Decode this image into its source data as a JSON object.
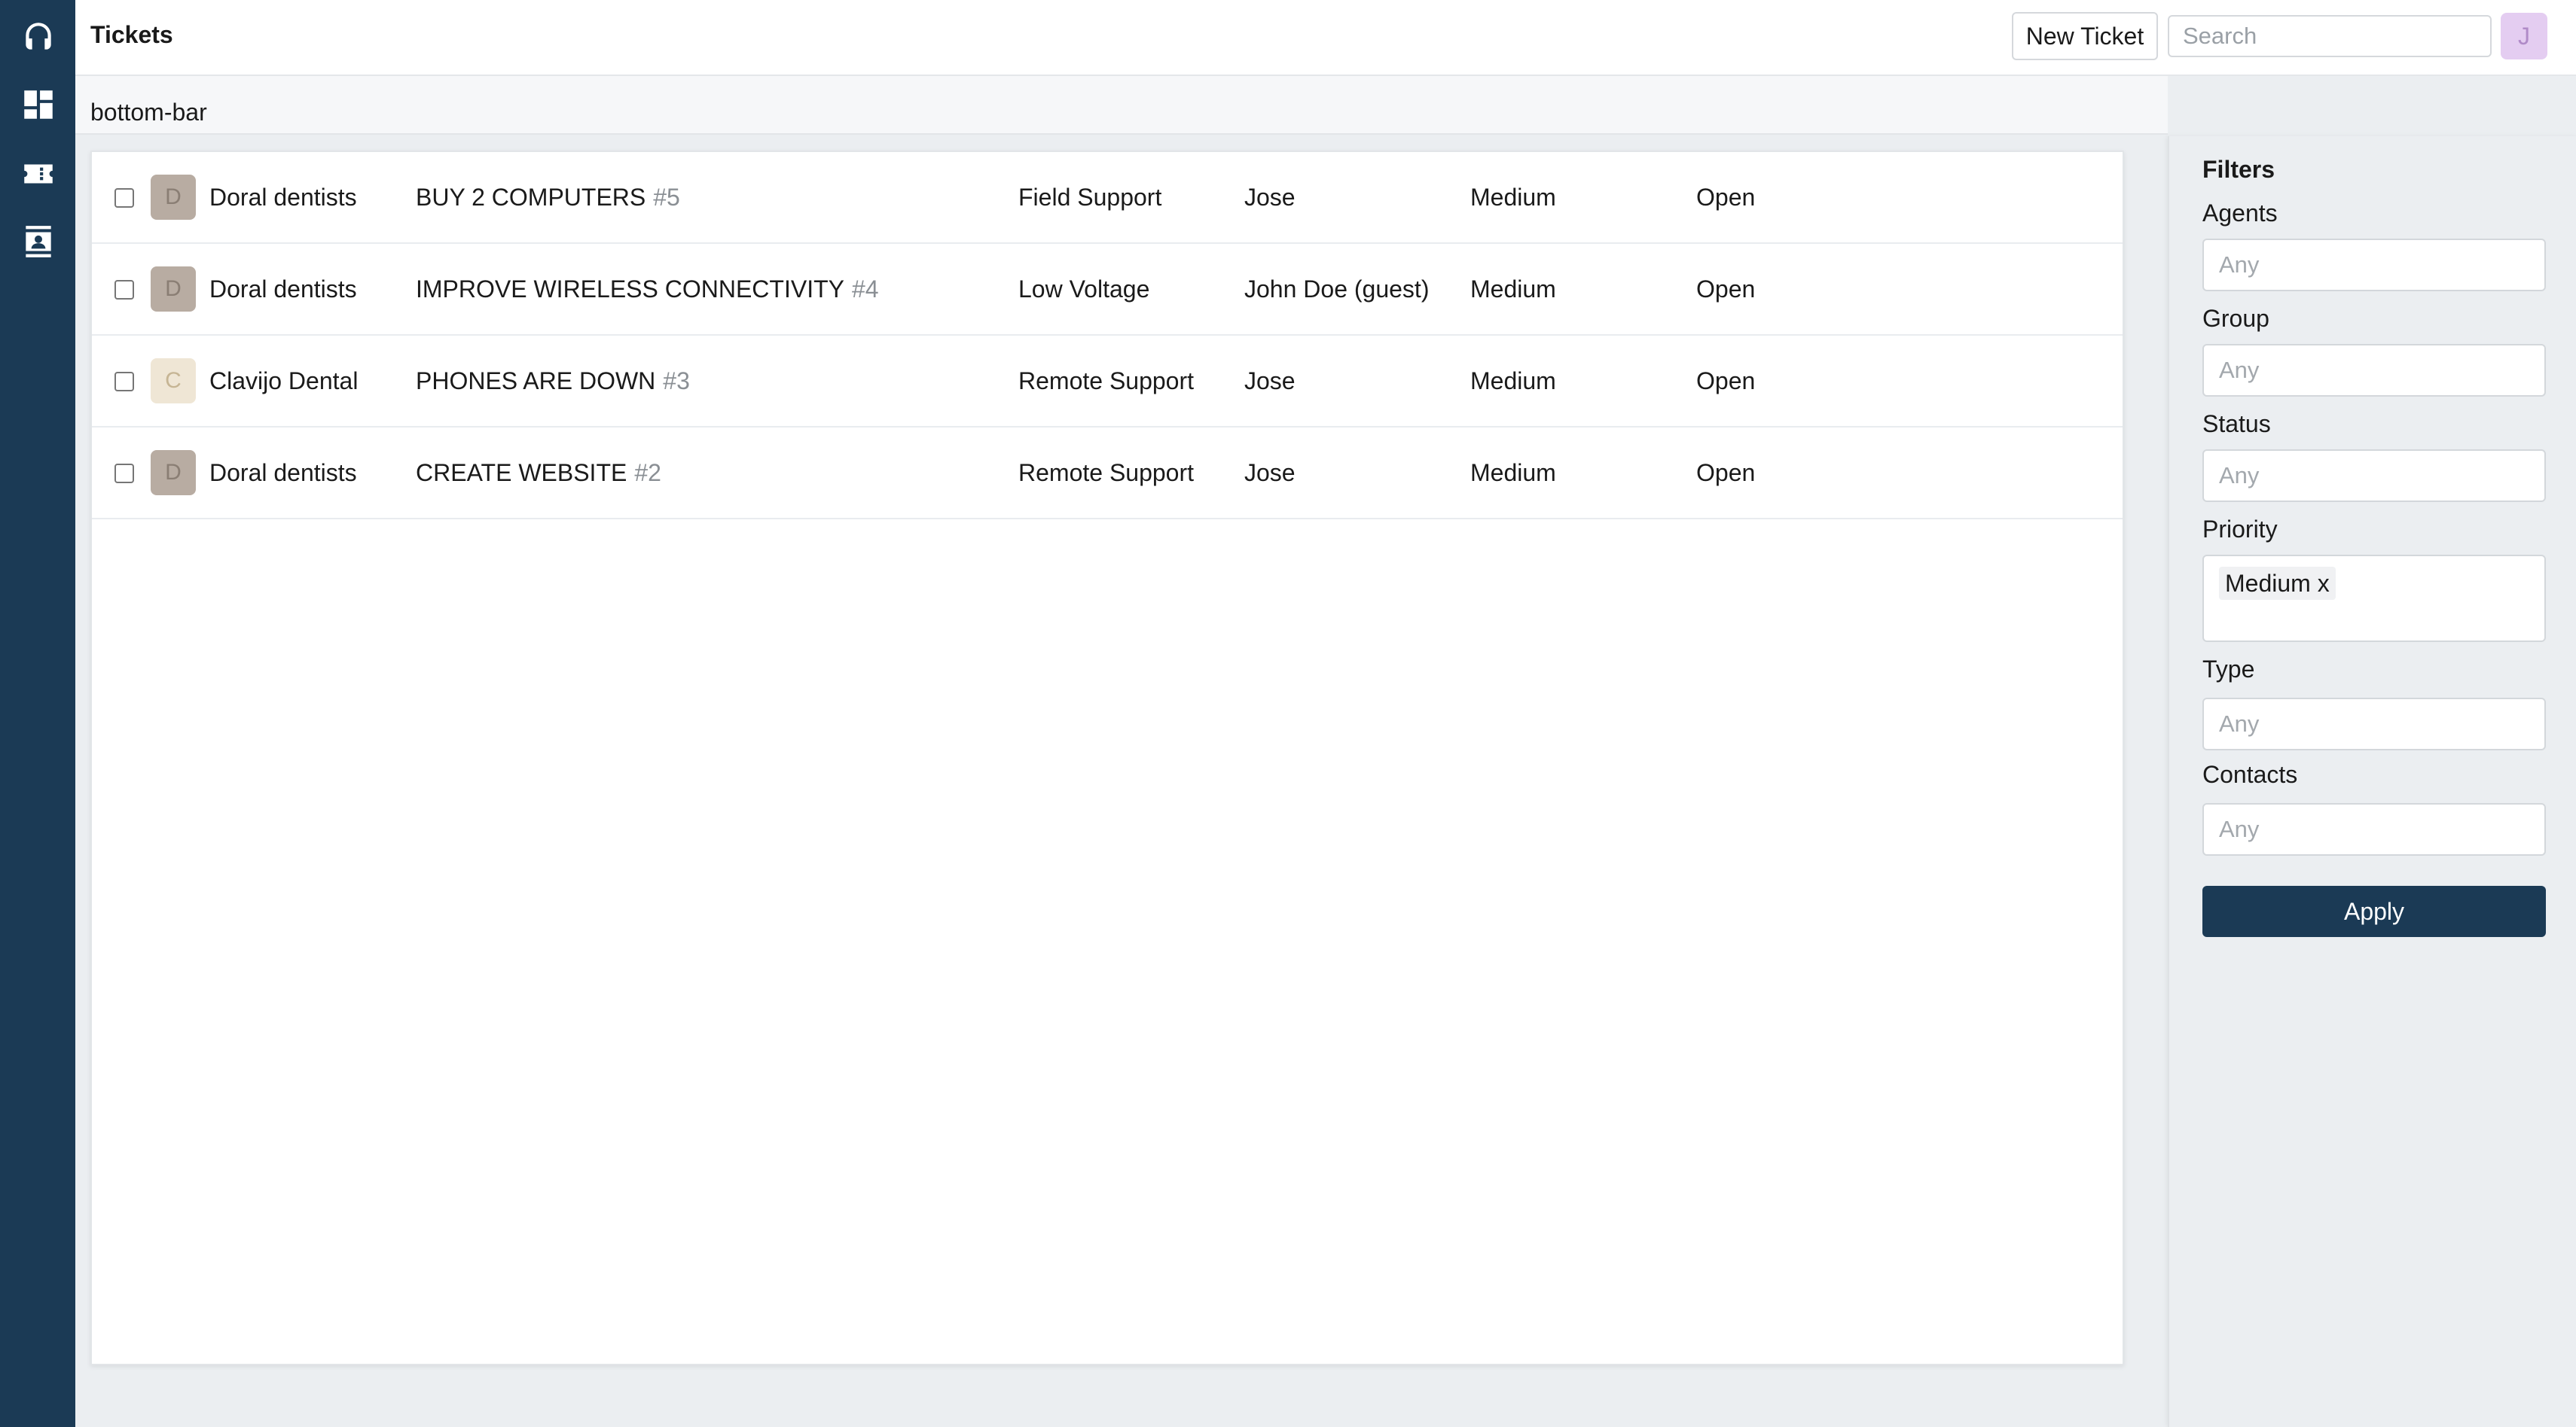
{
  "header": {
    "title": "Tickets",
    "new_ticket_label": "New Ticket",
    "search_placeholder": "Search",
    "user_initial": "J"
  },
  "sidebar": {
    "items": [
      {
        "icon": "headset-icon"
      },
      {
        "icon": "dashboard-icon"
      },
      {
        "icon": "ticket-icon"
      },
      {
        "icon": "contacts-icon"
      }
    ]
  },
  "subbar": {
    "label": "bottom-bar"
  },
  "tickets": [
    {
      "initial": "D",
      "company": "Doral dentists",
      "subject": "BUY 2 COMPUTERS",
      "number": "#5",
      "group": "Field Support",
      "agent": "Jose",
      "priority": "Medium",
      "status": "Open",
      "avatar_color": "#b8aca2",
      "avatar_text_color": "#8a7e74"
    },
    {
      "initial": "D",
      "company": "Doral dentists",
      "subject": "IMPROVE WIRELESS CONNECTIVITY",
      "number": "#4",
      "group": "Low Voltage",
      "agent": "John Doe (guest)",
      "priority": "Medium",
      "status": "Open",
      "avatar_color": "#b8aca2",
      "avatar_text_color": "#8a7e74"
    },
    {
      "initial": "C",
      "company": "Clavijo Dental",
      "subject": "PHONES ARE DOWN",
      "number": "#3",
      "group": "Remote Support",
      "agent": "Jose",
      "priority": "Medium",
      "status": "Open",
      "avatar_color": "#efe6d5",
      "avatar_text_color": "#c6b594"
    },
    {
      "initial": "D",
      "company": "Doral dentists",
      "subject": "CREATE WEBSITE",
      "number": "#2",
      "group": "Remote Support",
      "agent": "Jose",
      "priority": "Medium",
      "status": "Open",
      "avatar_color": "#b8aca2",
      "avatar_text_color": "#8a7e74"
    }
  ],
  "filters": {
    "title": "Filters",
    "agents": {
      "label": "Agents",
      "placeholder": "Any"
    },
    "group": {
      "label": "Group",
      "placeholder": "Any"
    },
    "status": {
      "label": "Status",
      "placeholder": "Any"
    },
    "priority": {
      "label": "Priority",
      "tags": [
        "Medium x"
      ]
    },
    "type": {
      "label": "Type",
      "placeholder": "Any"
    },
    "contacts": {
      "label": "Contacts",
      "placeholder": "Any"
    },
    "apply_label": "Apply"
  },
  "colors": {
    "sidebar": "#1b3a55",
    "accent": "#1b3a55",
    "user_avatar": "#e4cdf1"
  }
}
